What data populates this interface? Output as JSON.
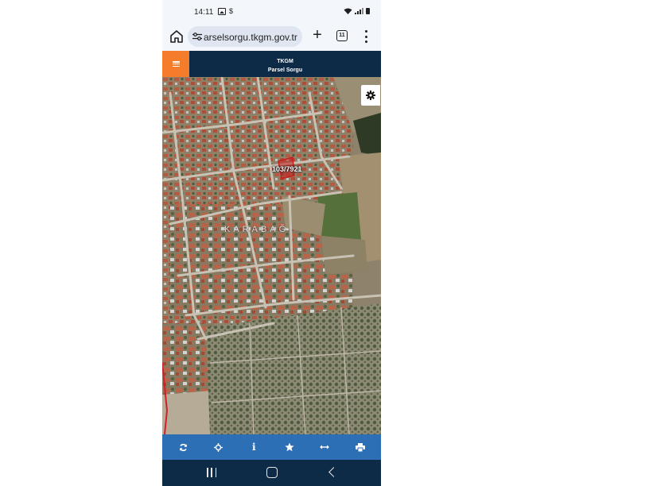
{
  "status_bar": {
    "time": "14:11",
    "left_icons": [
      "gallery-icon",
      "dollar-icon"
    ],
    "right_icons": [
      "wifi-icon",
      "signal-icon",
      "battery-icon"
    ]
  },
  "browser": {
    "url": "arselsorgu.tkgm.gov.tr",
    "tab_count": "11",
    "icons": [
      "home-icon",
      "site-settings-icon",
      "plus-icon",
      "tabs-icon",
      "more-vert-icon"
    ]
  },
  "app_header": {
    "title_line1": "TKGM",
    "title_line2": "Parsel Sorgu",
    "menu_icon": "hamburger-icon",
    "brand_colors": {
      "header": "#0d2a47",
      "menu_button": "#f57c2a",
      "toolbar": "#2d6fb5"
    }
  },
  "map": {
    "parcel_label": "103/7921",
    "district_label": "KARABAĞ",
    "settings_icon": "gear-icon",
    "parcel_color": "#c81e1e"
  },
  "toolbar": {
    "buttons": [
      {
        "name": "refresh-icon"
      },
      {
        "name": "locate-icon"
      },
      {
        "name": "info-icon",
        "label": "i"
      },
      {
        "name": "star-icon"
      },
      {
        "name": "measure-icon"
      },
      {
        "name": "print-icon"
      }
    ]
  },
  "nav_bar": {
    "icons": [
      "recents-icon",
      "home-icon",
      "back-icon"
    ]
  }
}
